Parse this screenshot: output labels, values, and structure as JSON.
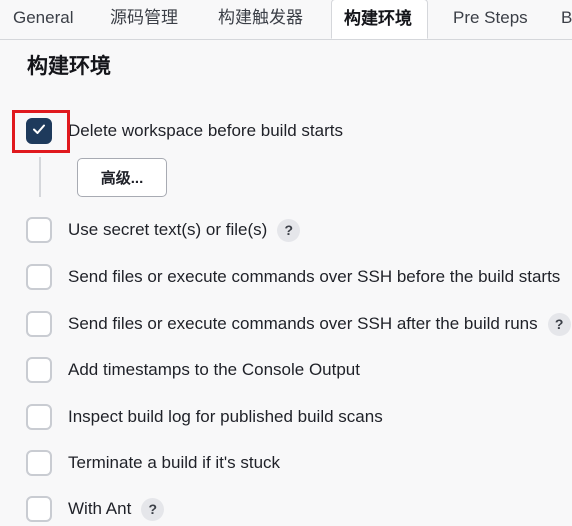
{
  "tabs": [
    {
      "label": "General"
    },
    {
      "label": "源码管理"
    },
    {
      "label": "构建触发器"
    },
    {
      "label": "构建环境"
    },
    {
      "label": "Pre Steps"
    },
    {
      "label": "B"
    }
  ],
  "active_tab": "构建环境",
  "section_title": "构建环境",
  "options": [
    {
      "label": "Delete workspace before build starts",
      "checked": true,
      "help": ""
    },
    {
      "label": "Use secret text(s) or file(s)",
      "checked": false,
      "help": "?"
    },
    {
      "label": "Send files or execute commands over SSH before the build starts",
      "checked": false,
      "help": ""
    },
    {
      "label": "Send files or execute commands over SSH after the build runs",
      "checked": false,
      "help": "?"
    },
    {
      "label": "Add timestamps to the Console Output",
      "checked": false,
      "help": ""
    },
    {
      "label": "Inspect build log for published build scans",
      "checked": false,
      "help": ""
    },
    {
      "label": "Terminate a build if it's stuck",
      "checked": false,
      "help": ""
    },
    {
      "label": "With Ant",
      "checked": false,
      "help": "?"
    }
  ],
  "advanced_button_label": "高级...",
  "colors": {
    "checked_fill": "#1e3a5c",
    "highlight_border": "#e0191e"
  }
}
